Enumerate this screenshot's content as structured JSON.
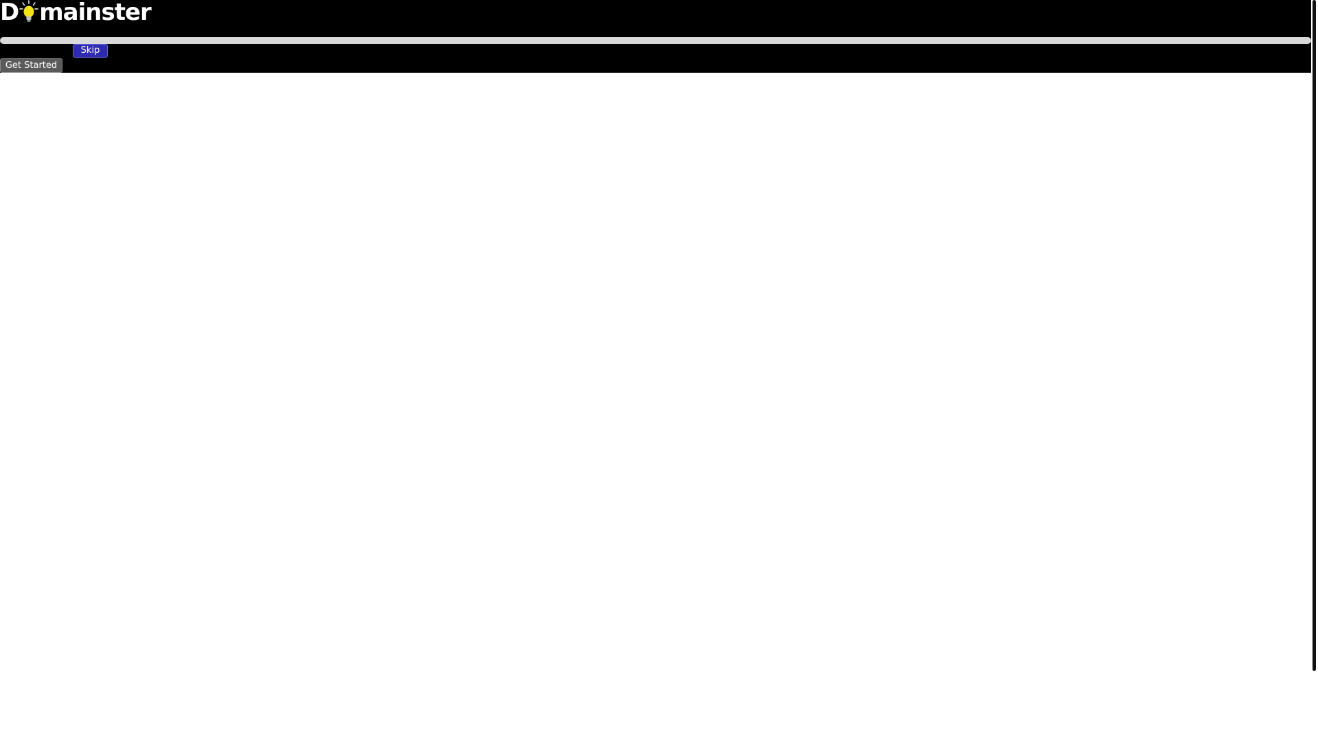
{
  "header": {
    "logo": {
      "prefix": "D",
      "suffix": "mainster",
      "icon": "lightbulb-icon",
      "bulb_color": "#f2e21a"
    }
  },
  "onboarding": {
    "progress_percent": 0,
    "skip_label": "Skip",
    "get_started_label": "Get Started"
  },
  "colors": {
    "panel_background": "#000000",
    "page_background": "#ffffff",
    "skip_button": "#2e2bb0",
    "get_started_button": "#5a5a5a",
    "progress_track": "#d9d9d9"
  }
}
